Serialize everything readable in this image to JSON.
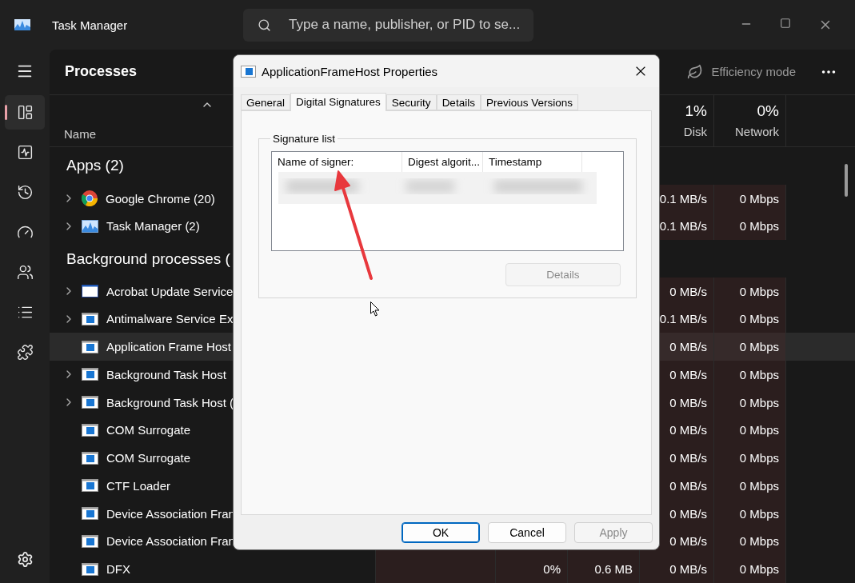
{
  "window": {
    "title": "Task Manager",
    "search": {
      "placeholder": "Type a name, publisher, or PID to se..."
    }
  },
  "sidebar": {
    "items": [
      {
        "selected": true
      },
      {
        "selected": false
      },
      {
        "selected": false
      },
      {
        "selected": false
      },
      {
        "selected": false
      },
      {
        "selected": false
      },
      {
        "selected": false
      }
    ]
  },
  "page": {
    "title": "Processes",
    "efficiency_mode": "Efficiency mode"
  },
  "table": {
    "name_column": "Name",
    "disk": {
      "percent": "1%",
      "label": "Disk"
    },
    "network": {
      "percent": "0%",
      "label": "Network"
    },
    "rows": [
      {
        "kind": "group",
        "label": "Apps (2)"
      },
      {
        "kind": "process",
        "name": "Google Chrome (20)",
        "expandable": true,
        "selected": false,
        "disk": "0.1 MB/s",
        "network": "0 Mbps"
      },
      {
        "kind": "process",
        "name": "Task Manager (2)",
        "expandable": true,
        "selected": false,
        "disk": "0.1 MB/s",
        "network": "0 Mbps"
      },
      {
        "kind": "group",
        "label": "Background processes ("
      },
      {
        "kind": "process",
        "name": "Acrobat Update Service",
        "expandable": true,
        "selected": false,
        "disk": "0 MB/s",
        "network": "0 Mbps"
      },
      {
        "kind": "process",
        "name": "Antimalware Service Ex",
        "expandable": true,
        "selected": false,
        "disk": "0.1 MB/s",
        "network": "0 Mbps"
      },
      {
        "kind": "process",
        "name": "Application Frame Host",
        "expandable": false,
        "selected": true,
        "disk": "0 MB/s",
        "network": "0 Mbps"
      },
      {
        "kind": "process",
        "name": "Background Task Host",
        "expandable": true,
        "selected": false,
        "disk": "0 MB/s",
        "network": "0 Mbps"
      },
      {
        "kind": "process",
        "name": "Background Task Host (",
        "expandable": true,
        "selected": false,
        "disk": "0 MB/s",
        "network": "0 Mbps"
      },
      {
        "kind": "process",
        "name": "COM Surrogate",
        "expandable": false,
        "selected": false,
        "disk": "0 MB/s",
        "network": "0 Mbps"
      },
      {
        "kind": "process",
        "name": "COM Surrogate",
        "expandable": false,
        "selected": false,
        "disk": "0 MB/s",
        "network": "0 Mbps"
      },
      {
        "kind": "process",
        "name": "CTF Loader",
        "expandable": false,
        "selected": false,
        "disk": "0 MB/s",
        "network": "0 Mbps"
      },
      {
        "kind": "process",
        "name": "Device Association Fran",
        "expandable": false,
        "selected": false,
        "disk": "0 MB/s",
        "network": "0 Mbps"
      },
      {
        "kind": "process",
        "name": "Device Association Fran",
        "expandable": false,
        "selected": false,
        "disk": "0 MB/s",
        "network": "0 Mbps"
      },
      {
        "kind": "process",
        "name": "DFX",
        "expandable": false,
        "selected": false,
        "cpu": "0%",
        "memory": "0.6 MB",
        "disk": "0 MB/s",
        "network": "0 Mbps"
      }
    ]
  },
  "dialog": {
    "title": "ApplicationFrameHost Properties",
    "tabs": [
      {
        "label": "General",
        "selected": false
      },
      {
        "label": "Digital Signatures",
        "selected": true
      },
      {
        "label": "Security",
        "selected": false
      },
      {
        "label": "Details",
        "selected": false
      },
      {
        "label": "Previous Versions",
        "selected": false
      }
    ],
    "group_label": "Signature list",
    "columns": [
      "Name of signer:",
      "Digest algorit...",
      "Timestamp"
    ],
    "details_button": {
      "label": "Details",
      "disabled": true
    },
    "buttons": [
      {
        "label": "OK",
        "default": true,
        "disabled": false
      },
      {
        "label": "Cancel",
        "default": false,
        "disabled": false
      },
      {
        "label": "Apply",
        "default": false,
        "disabled": true
      }
    ]
  }
}
